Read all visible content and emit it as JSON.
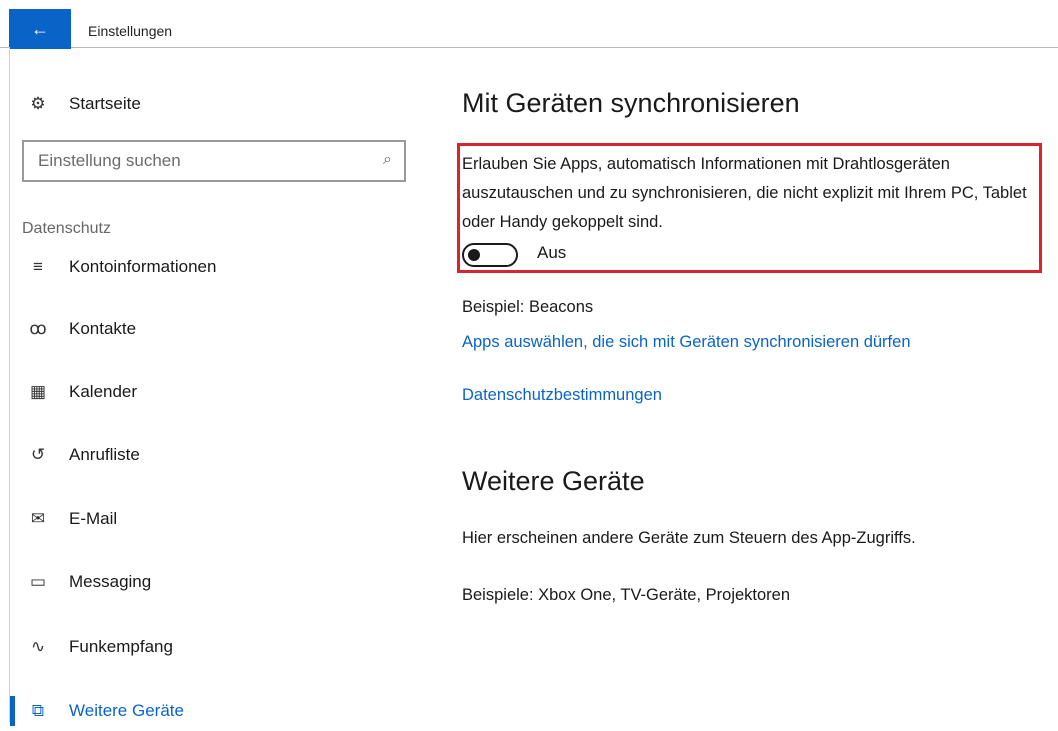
{
  "titlebar": {
    "back_icon": "←",
    "title": "Einstellungen"
  },
  "sidebar": {
    "home": {
      "icon": "⚙",
      "label": "Startseite"
    },
    "search": {
      "placeholder": "Einstellung suchen",
      "icon": "⌕"
    },
    "section": "Datenschutz",
    "items": [
      {
        "icon": "≡",
        "label": "Kontoinformationen"
      },
      {
        "icon": "ꝏ",
        "label": "Kontakte"
      },
      {
        "icon": "▦",
        "label": "Kalender"
      },
      {
        "icon": "↺",
        "label": "Anrufliste"
      },
      {
        "icon": "✉",
        "label": "E-Mail"
      },
      {
        "icon": "▭",
        "label": "Messaging"
      },
      {
        "icon": "∿",
        "label": "Funkempfang"
      },
      {
        "icon": "⧉",
        "label": "Weitere Geräte"
      }
    ]
  },
  "main": {
    "sync_title": "Mit Geräten synchronisieren",
    "sync_desc": "Erlauben Sie Apps, automatisch Informationen mit Drahtlosgeräten auszutauschen und zu synchronisieren, die nicht explizit mit Ihrem PC, Tablet oder Handy gekoppelt sind.",
    "toggle_state": "Aus",
    "example": "Beispiel: Beacons",
    "apps_link": "Apps auswählen, die sich mit Geräten synchronisieren dürfen",
    "privacy_link": "Datenschutzbestimmungen",
    "other_title": "Weitere Geräte",
    "other_desc": "Hier erscheinen andere Geräte zum Steuern des App-Zugriffs.",
    "other_examples": "Beispiele: Xbox One, TV-Geräte, Projektoren"
  },
  "colors": {
    "accent": "#0a64c8",
    "highlight": "#d6252f"
  }
}
